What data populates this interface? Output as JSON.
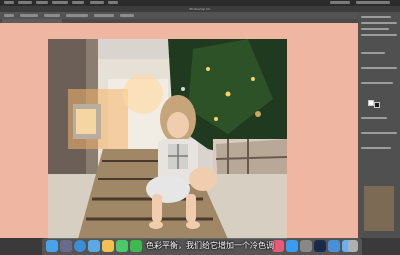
{
  "app": {
    "name": "Photoshop",
    "window_title": "Photoshop CC"
  },
  "dock": {
    "icons": [
      "finder-icon",
      "launchpad-icon",
      "safari-icon",
      "mail-icon",
      "photos-icon",
      "messages-icon",
      "facetime-icon",
      "music-icon",
      "appstore-icon",
      "settings-icon",
      "photoshop-icon",
      "files-icon",
      "folder-icon",
      "trash-icon"
    ]
  },
  "subtitle": "色彩平衡，我们给它增加一个冷色调",
  "colors": {
    "canvas_bg": "#efb7a1",
    "workspace": "#3a3a3a",
    "panel": "#505050"
  }
}
